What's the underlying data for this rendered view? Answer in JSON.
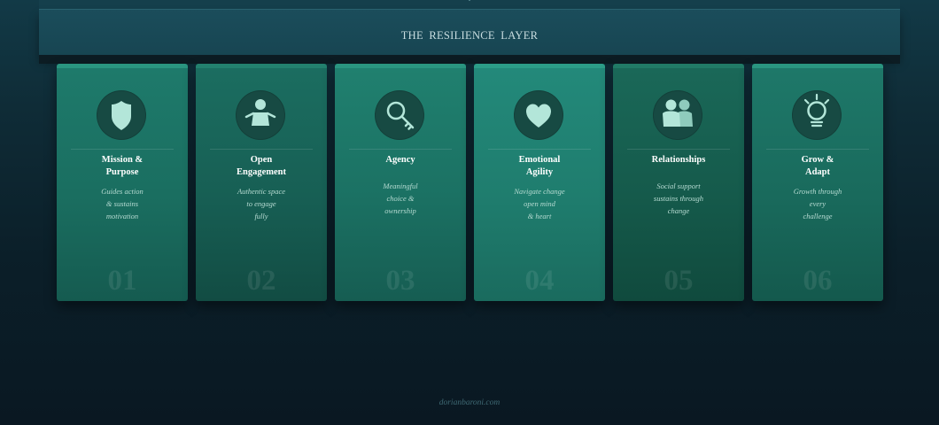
{
  "header": {
    "title": "THE  RESILIENCE  LAYER"
  },
  "colors": {
    "icon_fill": "#b3e6d9",
    "icon_circle": "#174a43",
    "accent": "#2a9580"
  },
  "cards": [
    {
      "icon": "shield-icon",
      "title_lines": [
        "Mission &",
        "Purpose"
      ],
      "desc_lines": [
        "Guides action",
        "& sustains",
        "motivation"
      ],
      "number": "01"
    },
    {
      "icon": "person-open-arms-icon",
      "title_lines": [
        "Open",
        "Engagement"
      ],
      "desc_lines": [
        "Authentic space",
        "to engage",
        "fully"
      ],
      "number": "02"
    },
    {
      "icon": "key-icon",
      "title_lines": [
        "Agency"
      ],
      "desc_lines": [
        "Meaningful",
        "choice &",
        "ownership"
      ],
      "number": "03"
    },
    {
      "icon": "heart-icon",
      "title_lines": [
        "Emotional",
        "Agility"
      ],
      "desc_lines": [
        "Navigate change",
        "open mind",
        "& heart"
      ],
      "number": "04"
    },
    {
      "icon": "people-icon",
      "title_lines": [
        "Relationships"
      ],
      "desc_lines": [
        "Social support",
        "sustains through",
        "change"
      ],
      "number": "05"
    },
    {
      "icon": "lightbulb-icon",
      "title_lines": [
        "Grow &",
        "Adapt"
      ],
      "desc_lines": [
        "Growth through",
        "every",
        "challenge"
      ],
      "number": "06"
    }
  ],
  "footer": {
    "credit": "dorianbaroni.com"
  }
}
